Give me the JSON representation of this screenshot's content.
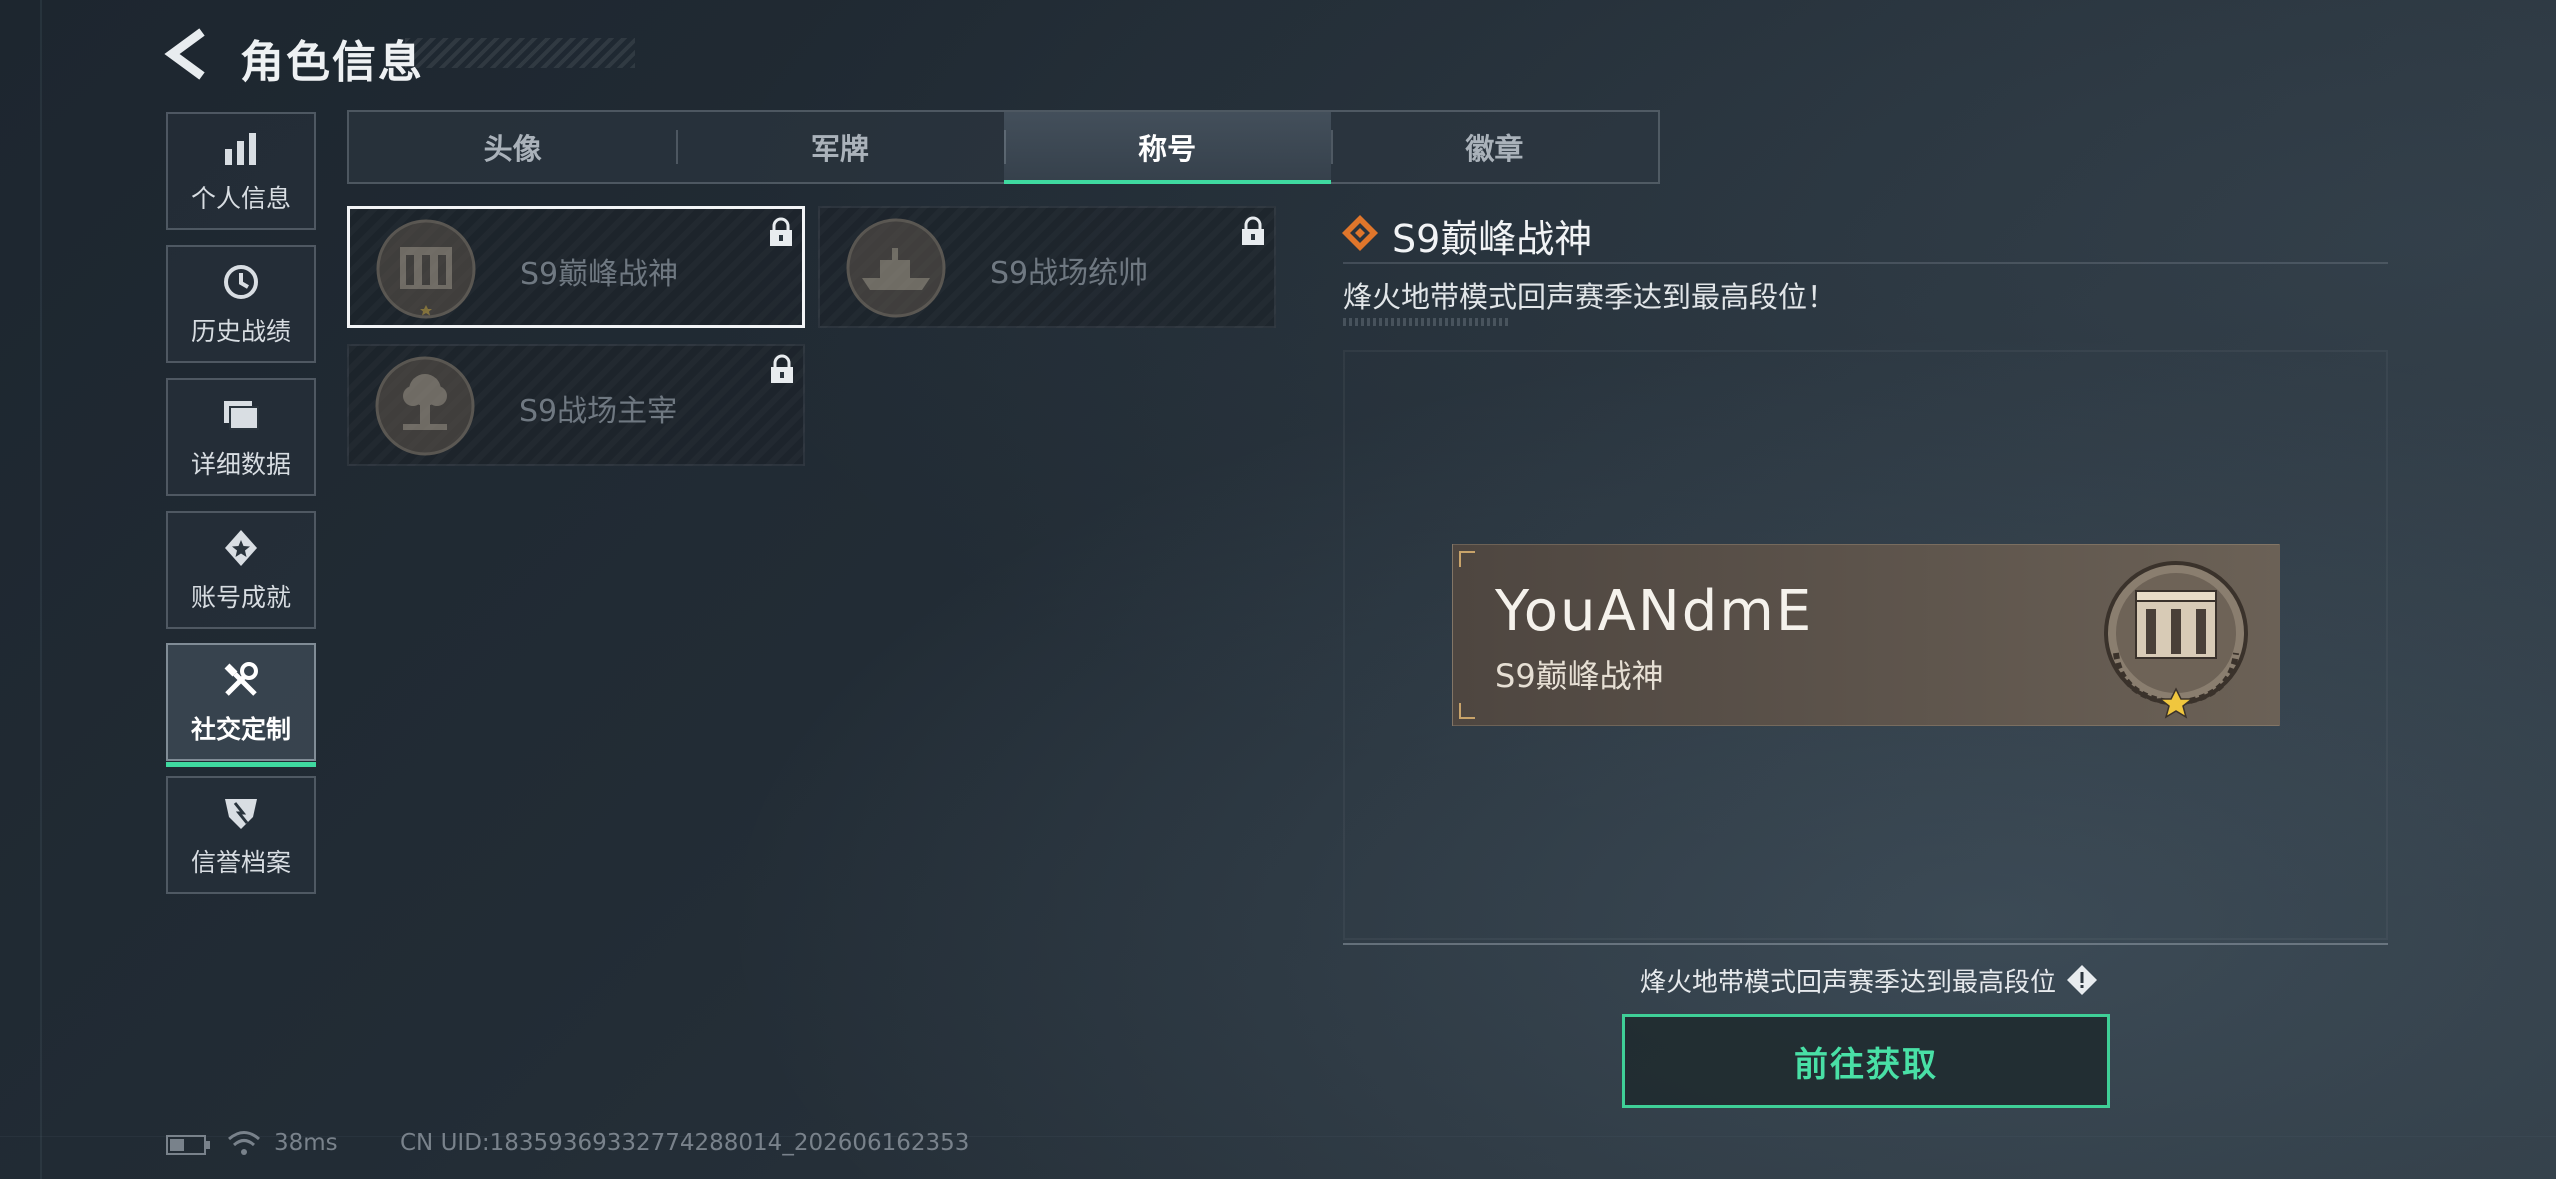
{
  "header": {
    "title": "角色信息"
  },
  "sidebar": {
    "items": [
      {
        "label": "个人信息",
        "icon": "bar-chart-icon",
        "active": false
      },
      {
        "label": "历史战绩",
        "icon": "clock-history-icon",
        "active": false
      },
      {
        "label": "详细数据",
        "icon": "folder-icon",
        "active": false
      },
      {
        "label": "账号成就",
        "icon": "medal-icon",
        "active": false
      },
      {
        "label": "社交定制",
        "icon": "tools-icon",
        "active": true
      },
      {
        "label": "信誉档案",
        "icon": "shield-icon",
        "active": false
      }
    ]
  },
  "tabs": [
    {
      "label": "头像",
      "active": false
    },
    {
      "label": "军牌",
      "active": false
    },
    {
      "label": "称号",
      "active": true
    },
    {
      "label": "徽章",
      "active": false
    }
  ],
  "titles": [
    {
      "name": "S9巅峰战神",
      "locked": true,
      "selected": true,
      "emblem": "building-emblem-icon"
    },
    {
      "name": "S9战场统帅",
      "locked": true,
      "selected": false,
      "emblem": "ship-emblem-icon"
    },
    {
      "name": "S9战场主宰",
      "locked": true,
      "selected": false,
      "emblem": "explosion-emblem-icon"
    }
  ],
  "detail": {
    "title": "S9巅峰战神",
    "description": "烽火地带模式回声赛季达到最高段位！",
    "preview": {
      "player_name": "YouANdmE",
      "title": "S9巅峰战神"
    },
    "requirement": "烽火地带模式回声赛季达到最高段位",
    "action_label": "前往获取"
  },
  "status": {
    "ping": "38ms",
    "uid": "CN UID:18359369332774288014_202606162353"
  },
  "colors": {
    "accent": "#3fd9a0",
    "card_bronze": "#5b524a",
    "text_muted": "#79828b"
  }
}
